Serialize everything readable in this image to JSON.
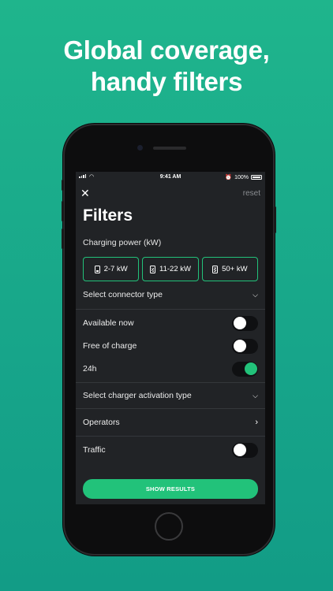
{
  "headline": {
    "line1": "Global coverage,",
    "line2": "handy filters"
  },
  "status_bar": {
    "time": "9:41 AM",
    "battery_percent": "100%",
    "battery_level": 1.0
  },
  "header": {
    "close_icon": "close-icon",
    "reset_label": "reset",
    "title": "Filters"
  },
  "charging_power": {
    "label": "Charging power (kW)",
    "options": [
      {
        "label": "2-7 kW",
        "icon": "plug-low-icon",
        "selected": true
      },
      {
        "label": "11-22 kW",
        "icon": "plug-medium-icon",
        "selected": true
      },
      {
        "label": "50+ kW",
        "icon": "plug-high-icon",
        "selected": true
      }
    ]
  },
  "connector": {
    "label": "Select connector type",
    "icon": "chevron-down-icon"
  },
  "toggles": [
    {
      "label": "Available now",
      "on": false
    },
    {
      "label": "Free of charge",
      "on": false
    },
    {
      "label": "24h",
      "on": true
    }
  ],
  "activation": {
    "label": "Select charger activation type",
    "icon": "chevron-down-icon"
  },
  "operators": {
    "label": "Operators",
    "icon": "chevron-right-icon"
  },
  "traffic": {
    "label": "Traffic",
    "on": false
  },
  "cta": {
    "label": "SHOW RESULTS"
  },
  "colors": {
    "accent": "#22c27a",
    "background": "#1fb58c",
    "panel": "#212326"
  }
}
